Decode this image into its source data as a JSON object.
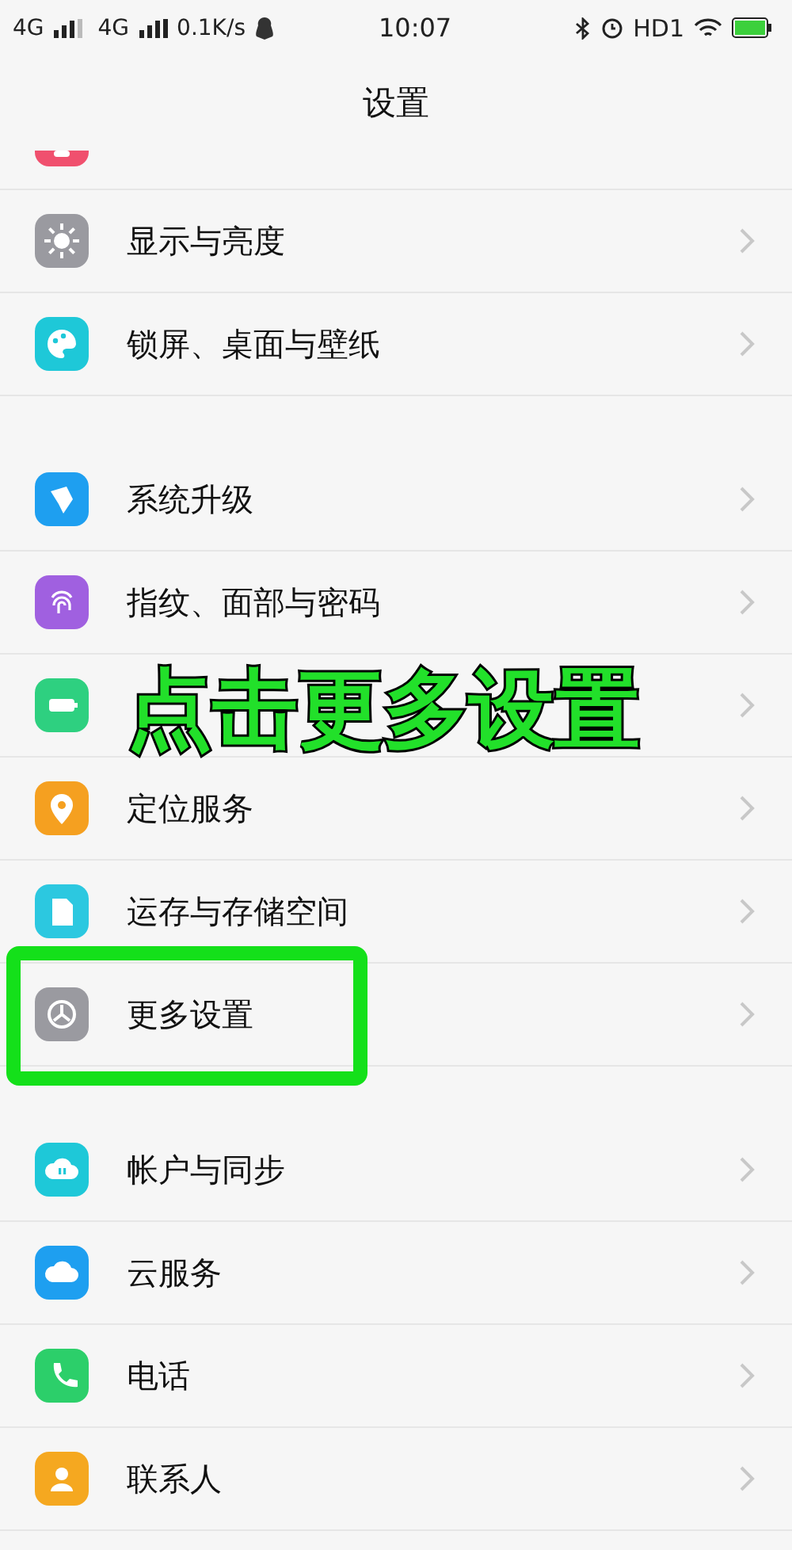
{
  "status_bar": {
    "network_1": "4G",
    "network_2": "4G",
    "speed": "0.1K/s",
    "time": "10:07",
    "hd": "HD1"
  },
  "header": {
    "title": "设置"
  },
  "groups": [
    {
      "items": [
        {
          "color": "#f0506e",
          "cut": true,
          "highlighted": false
        },
        {
          "label": "显示与亮度",
          "color": "#9a9aa0",
          "cut": false,
          "highlighted": false
        },
        {
          "label": "锁屏、桌面与壁纸",
          "color": "#1ec8d8",
          "cut": false,
          "highlighted": false
        }
      ]
    },
    {
      "items": [
        {
          "label": "系统升级",
          "color": "#1e9ff0",
          "cut": false,
          "highlighted": false
        },
        {
          "label": "指纹、面部与密码",
          "color": "#a060e0",
          "cut": false,
          "highlighted": false
        },
        {
          "color": "#2ed080",
          "cut": false,
          "highlighted": false
        },
        {
          "label": "定位服务",
          "color": "#f5a020",
          "cut": false,
          "highlighted": false
        },
        {
          "label": "运存与存储空间",
          "color": "#2cc8e0",
          "cut": false,
          "highlighted": false
        },
        {
          "label": "更多设置",
          "color": "#9a9aa0",
          "cut": false,
          "highlighted": true
        }
      ]
    },
    {
      "items": [
        {
          "label": "帐户与同步",
          "color": "#1ec8d8",
          "cut": false,
          "highlighted": false
        },
        {
          "label": "云服务",
          "color": "#1e9ff0",
          "cut": false,
          "highlighted": false
        },
        {
          "label": "电话",
          "color": "#2ccf6a",
          "cut": false,
          "highlighted": false
        },
        {
          "label": "联系人",
          "color": "#f5a820",
          "cut": false,
          "highlighted": false
        }
      ]
    }
  ],
  "callout": {
    "text": "点击更多设置"
  }
}
